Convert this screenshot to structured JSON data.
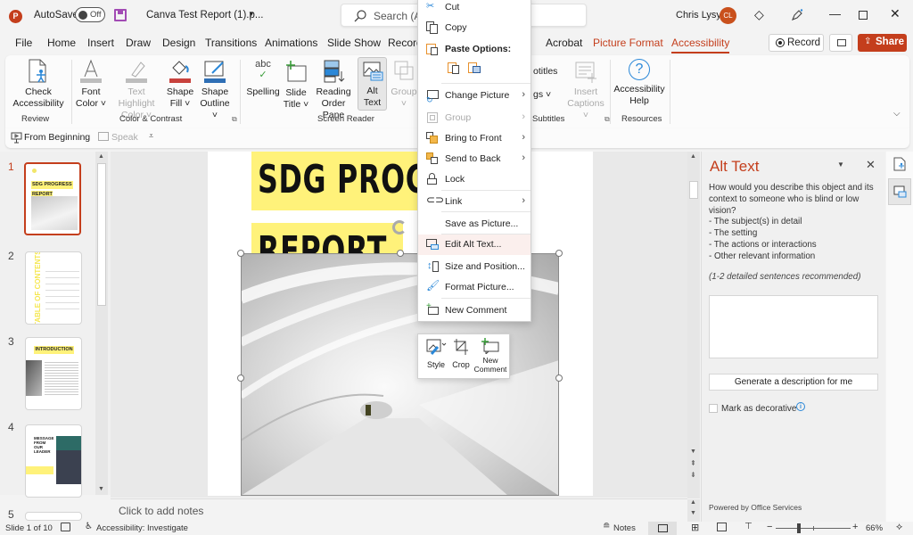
{
  "titlebar": {
    "autosave_label": "AutoSave",
    "autosave_state": "Off",
    "filename": "Canva Test Report (1).p...",
    "search_placeholder": "Search (Al",
    "user_name": "Chris Lysy",
    "user_initials": "CL"
  },
  "tabs": [
    {
      "label": "File"
    },
    {
      "label": "Home"
    },
    {
      "label": "Insert"
    },
    {
      "label": "Draw"
    },
    {
      "label": "Design"
    },
    {
      "label": "Transitions"
    },
    {
      "label": "Animations"
    },
    {
      "label": "Slide Show"
    },
    {
      "label": "Record"
    },
    {
      "label": "Acrobat"
    },
    {
      "label": "Picture Format"
    },
    {
      "label": "Accessibility"
    }
  ],
  "header_buttons": {
    "record": "Record",
    "share": "Share"
  },
  "ribbon": {
    "check_accessibility": [
      "Check",
      "Accessibility"
    ],
    "font_color": [
      "Font",
      "Color ˅"
    ],
    "text_highlight": [
      "Text Highlight",
      "Color ˅"
    ],
    "shape_fill": [
      "Shape",
      "Fill ˅"
    ],
    "shape_outline": [
      "Shape",
      "Outline ˅"
    ],
    "spelling": "Spelling",
    "slide_title": [
      "Slide",
      "Title ˅"
    ],
    "reading_order": [
      "Reading",
      "Order Pane"
    ],
    "alt_text": [
      "Alt",
      "Text"
    ],
    "group": [
      "Group",
      "˅"
    ],
    "subtitles_partial": "otitles",
    "settings_partial": "gs ˅",
    "insert_captions": [
      "Insert",
      "Captions ˅"
    ],
    "accessibility_help": [
      "Accessibility",
      "Help"
    ],
    "groups": {
      "review": "Review",
      "color_contrast": "Color & Contrast",
      "screen_reader": "Screen Reader",
      "subtitles": "Subtitles",
      "resources": "Resources"
    }
  },
  "qat": {
    "from_beginning": "From Beginning",
    "speak": "Speak"
  },
  "context_menu": {
    "items": [
      {
        "label": "Cut",
        "icon": "scissors-icon",
        "disabled": false
      },
      {
        "label": "Copy",
        "icon": "copy-icon",
        "disabled": false
      },
      {
        "label": "Paste Options:",
        "icon": "paste-icon",
        "header": true
      },
      {
        "label": "Change Picture",
        "icon": "change-picture-icon",
        "submenu": true
      },
      {
        "label": "Group",
        "icon": "group-icon",
        "disabled": true,
        "submenu": true
      },
      {
        "label": "Bring to Front",
        "icon": "bring-front-icon",
        "submenu": true
      },
      {
        "label": "Send to Back",
        "icon": "send-back-icon",
        "submenu": true
      },
      {
        "label": "Lock",
        "icon": "lock-icon"
      },
      {
        "label": "Link",
        "icon": "link-icon",
        "submenu": true
      },
      {
        "label": "Save as Picture...",
        "icon": ""
      },
      {
        "label": "Edit Alt Text...",
        "icon": "alt-text-icon",
        "highlighted": true
      },
      {
        "label": "Size and Position...",
        "icon": "size-position-icon"
      },
      {
        "label": "Format Picture...",
        "icon": "format-picture-icon"
      },
      {
        "label": "New Comment",
        "icon": "new-comment-icon"
      }
    ]
  },
  "mini_toolbar": {
    "style": "Style",
    "crop": "Crop",
    "new_comment": [
      "New",
      "Comment"
    ]
  },
  "slide": {
    "title_line1": "SDG PROGRESS",
    "title_line2": "REPORT"
  },
  "thumbnails": [
    {
      "num": "1",
      "title": "SDG PROGRESS REPORT",
      "selected": true
    },
    {
      "num": "2",
      "title": "TABLE OF CONTENTS"
    },
    {
      "num": "3",
      "title": "INTRODUCTION"
    },
    {
      "num": "4",
      "title": "MESSAGE FROM OUR LEADER"
    },
    {
      "num": "5"
    }
  ],
  "notes_placeholder": "Click to add notes",
  "alt_pane": {
    "title": "Alt Text",
    "prompt": "How would you describe this object and its context to someone who is blind or low vision?",
    "bullets": [
      "- The subject(s) in detail",
      "- The setting",
      "- The actions or interactions",
      "- Other relevant information"
    ],
    "hint": "(1-2 detailed sentences recommended)",
    "textarea_value": "",
    "generate_button": "Generate a description for me",
    "decorative_label": "Mark as decorative",
    "decorative_checked": false,
    "powered_by": "Powered by Office Services"
  },
  "status": {
    "slide_count": "Slide 1 of 10",
    "accessibility": "Accessibility: Investigate",
    "notes": "Notes",
    "zoom": "66%",
    "zoom_level": 0.66
  },
  "colors": {
    "accent": "#c43e1c",
    "highlight_yellow": "#fff27a",
    "link_blue": "#2b88d8"
  }
}
